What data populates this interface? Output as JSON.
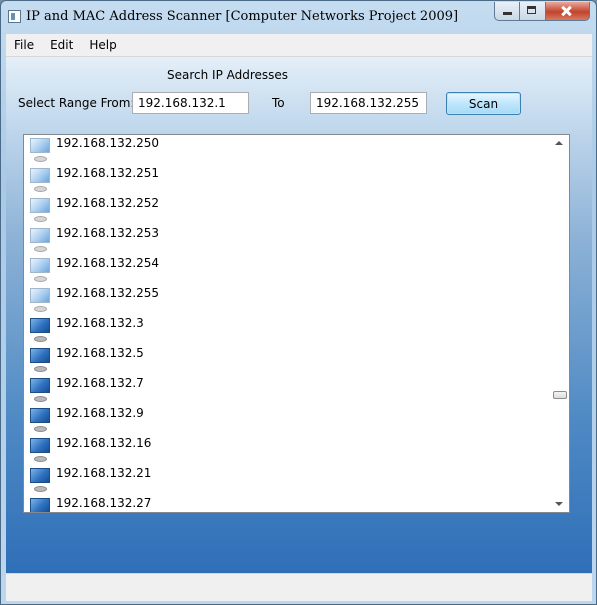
{
  "window": {
    "title": "IP and MAC Address Scanner [Computer Networks Project 2009]",
    "controls": [
      "minimize",
      "maximize",
      "close"
    ]
  },
  "menu": {
    "items": [
      {
        "label": "File"
      },
      {
        "label": "Edit"
      },
      {
        "label": "Help"
      }
    ]
  },
  "search": {
    "heading": "Search IP Addresses",
    "from_label": "Select Range From:",
    "from_value": "192.168.132.1",
    "to_label": "To",
    "to_value": "192.168.132.255",
    "scan_label": "Scan"
  },
  "results": {
    "items": [
      {
        "ip": "192.168.132.250",
        "icon": "computer-icon-light"
      },
      {
        "ip": "192.168.132.251",
        "icon": "computer-icon-light"
      },
      {
        "ip": "192.168.132.252",
        "icon": "computer-icon-light"
      },
      {
        "ip": "192.168.132.253",
        "icon": "computer-icon-light"
      },
      {
        "ip": "192.168.132.254",
        "icon": "computer-icon-light"
      },
      {
        "ip": "192.168.132.255",
        "icon": "computer-icon-light"
      },
      {
        "ip": "192.168.132.3",
        "icon": "computer-icon-dark"
      },
      {
        "ip": "192.168.132.5",
        "icon": "computer-icon-dark"
      },
      {
        "ip": "192.168.132.7",
        "icon": "computer-icon-dark"
      },
      {
        "ip": "192.168.132.9",
        "icon": "computer-icon-dark"
      },
      {
        "ip": "192.168.132.16",
        "icon": "computer-icon-dark"
      },
      {
        "ip": "192.168.132.21",
        "icon": "computer-icon-dark"
      },
      {
        "ip": "192.168.132.27",
        "icon": "computer-icon-dark"
      }
    ]
  },
  "theme": {
    "accent": "#2f6fb8",
    "button_border": "#3c7fb1"
  }
}
